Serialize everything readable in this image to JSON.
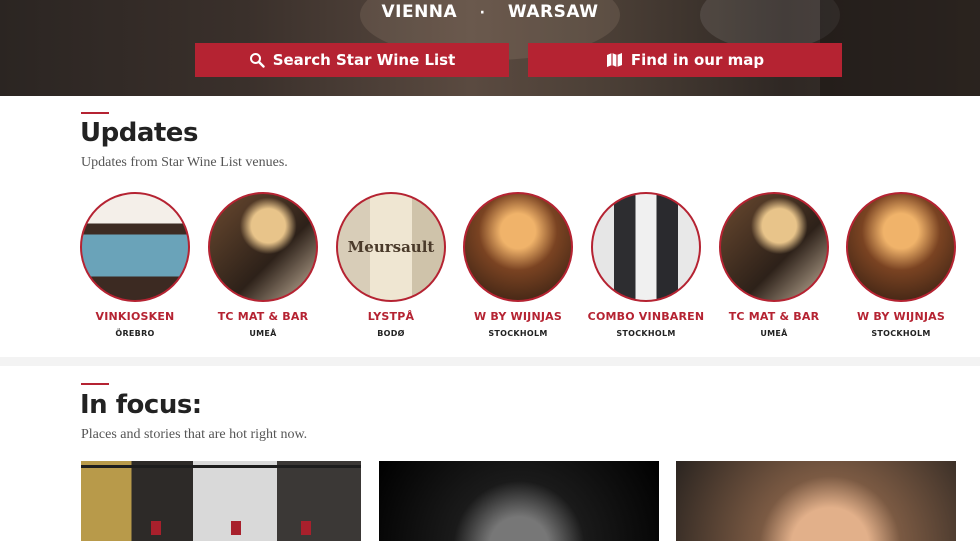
{
  "hero": {
    "cities": [
      "VIENNA",
      "WARSAW"
    ],
    "separator": "·",
    "search_button": "Search Star Wine List",
    "map_button": "Find in our map"
  },
  "updates": {
    "title": "Updates",
    "subtitle": "Updates from Star Wine List venues.",
    "venues": [
      {
        "name": "VINKIOSKEN",
        "city": "ÖREBRO"
      },
      {
        "name": "TC MAT & BAR",
        "city": "UMEÅ"
      },
      {
        "name": "LYSTPÅ",
        "city": "BODØ"
      },
      {
        "name": "W BY WIJNJAS",
        "city": "STOCKHOLM"
      },
      {
        "name": "COMBO VINBAREN",
        "city": "STOCKHOLM"
      },
      {
        "name": "TC MAT & BAR",
        "city": "UMEÅ"
      },
      {
        "name": "W BY WIJNJAS",
        "city": "STOCKHOLM"
      }
    ],
    "label_word": "Meursault"
  },
  "focus": {
    "title": "In focus:",
    "subtitle": "Places and stories that are hot right now."
  },
  "colors": {
    "accent": "#b52332"
  }
}
